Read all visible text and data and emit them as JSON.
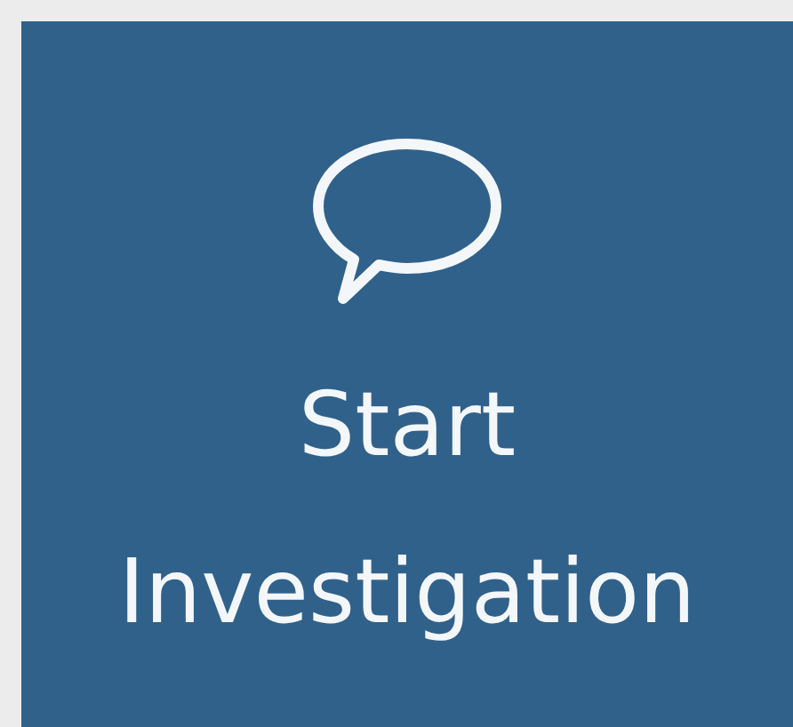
{
  "tile": {
    "label": "Start Investigation"
  }
}
